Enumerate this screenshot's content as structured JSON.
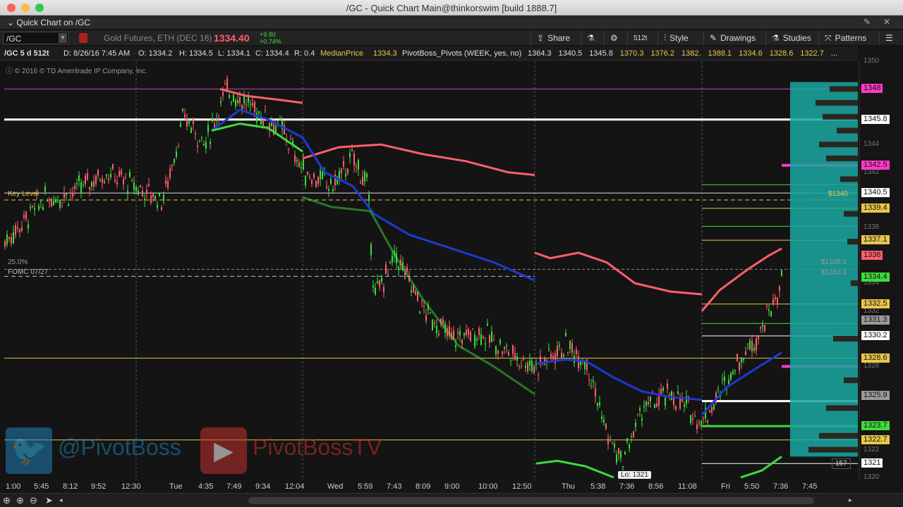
{
  "window": {
    "title": "/GC - Quick Chart Main@thinkorswim [build 1888.7]"
  },
  "quick_chart": {
    "label": "Quick Chart on /GC"
  },
  "toolbar": {
    "symbol": "/GC",
    "description": "Gold Futures, ETH (DEC 16)",
    "last_price": "1334.40",
    "change": "+9.80",
    "change_pct": "+0.74%",
    "aggregation": "512t",
    "share_label": "Share",
    "style_label": "Style",
    "drawings_label": "Drawings",
    "studies_label": "Studies",
    "patterns_label": "Patterns"
  },
  "infobar": {
    "chart_id": "/GC 5 d 512t",
    "date": "D: 8/26/16 7:45 AM",
    "open": "O: 1334.2",
    "high": "H: 1334.5",
    "low": "L: 1334.1",
    "close": "C: 1334.4",
    "range": "R: 0.4",
    "median_label": "MedianPrice",
    "median_value": "1334.3",
    "pivots_label": "PivotBoss_Pivots (WEEK, yes, no)",
    "pivot_values": [
      "1364.3",
      "1340.5",
      "1345.8",
      "1370.3",
      "1376.2",
      "1382.",
      "1388.1",
      "1334.6",
      "1328.6",
      "1322.7",
      "..."
    ]
  },
  "chart": {
    "copyright": "© 2016 © TD Ameritrade IP Company, Inc.",
    "key_level_label": "Key Level",
    "fomc_label": "FOMC 07/27",
    "pct_label": "25.0%",
    "vp_label_1": "$1335.1",
    "vp_label_2": "$1334.3",
    "vp_label_3": "$1340",
    "low_label": "Lo: 1321",
    "count_badge": "157",
    "colors": {
      "bull": "#3ddc3d",
      "bear": "#ff5f6d",
      "ma_blue": "#1e3ad0",
      "pivot_magenta": "#ff3ac8",
      "profile": "#1aa7a1"
    }
  },
  "price_axis": {
    "ticks": [
      "1350",
      "1344",
      "1342",
      "1338",
      "1334",
      "1332",
      "1328",
      "1322",
      "1320"
    ],
    "labels": [
      {
        "text": "1348",
        "color": "#ff3ac8"
      },
      {
        "text": "1345.8",
        "color": "#ffffff"
      },
      {
        "text": "1342.5",
        "color": "#ff3ac8"
      },
      {
        "text": "1340.5",
        "color": "#ffffff"
      },
      {
        "text": "1339.4",
        "color": "#e8c64a"
      },
      {
        "text": "1337.1",
        "color": "#e8c64a"
      },
      {
        "text": "1336",
        "color": "#ff5f6d"
      },
      {
        "text": "1334.4",
        "color": "#3ddc3d"
      },
      {
        "text": "1332.5",
        "color": "#e8c64a"
      },
      {
        "text": "1331.3",
        "color": "#9a9a9a"
      },
      {
        "text": "1330.2",
        "color": "#ffffff"
      },
      {
        "text": "1328.6",
        "color": "#e8c64a"
      },
      {
        "text": "1325.9",
        "color": "#9a9a9a"
      },
      {
        "text": "1323.7",
        "color": "#3ddc3d"
      },
      {
        "text": "1322.7",
        "color": "#e8c64a"
      },
      {
        "text": "1321",
        "color": "#ffffff"
      }
    ]
  },
  "time_axis": {
    "labels": [
      "1:00",
      "5:45",
      "8:12",
      "9:52",
      "12:30",
      "Tue",
      "4:35",
      "7:49",
      "9:34",
      "12:04",
      "Wed",
      "5:59",
      "7:43",
      "8:09",
      "9:00",
      "10:00",
      "12:50",
      "Thu",
      "5:38",
      "7:36",
      "8:56",
      "11:08",
      "Fri",
      "5:50",
      "7:36",
      "7:45"
    ]
  },
  "watermark": {
    "twitter": "@PivotBoss",
    "youtube": "PivotBossTV"
  }
}
